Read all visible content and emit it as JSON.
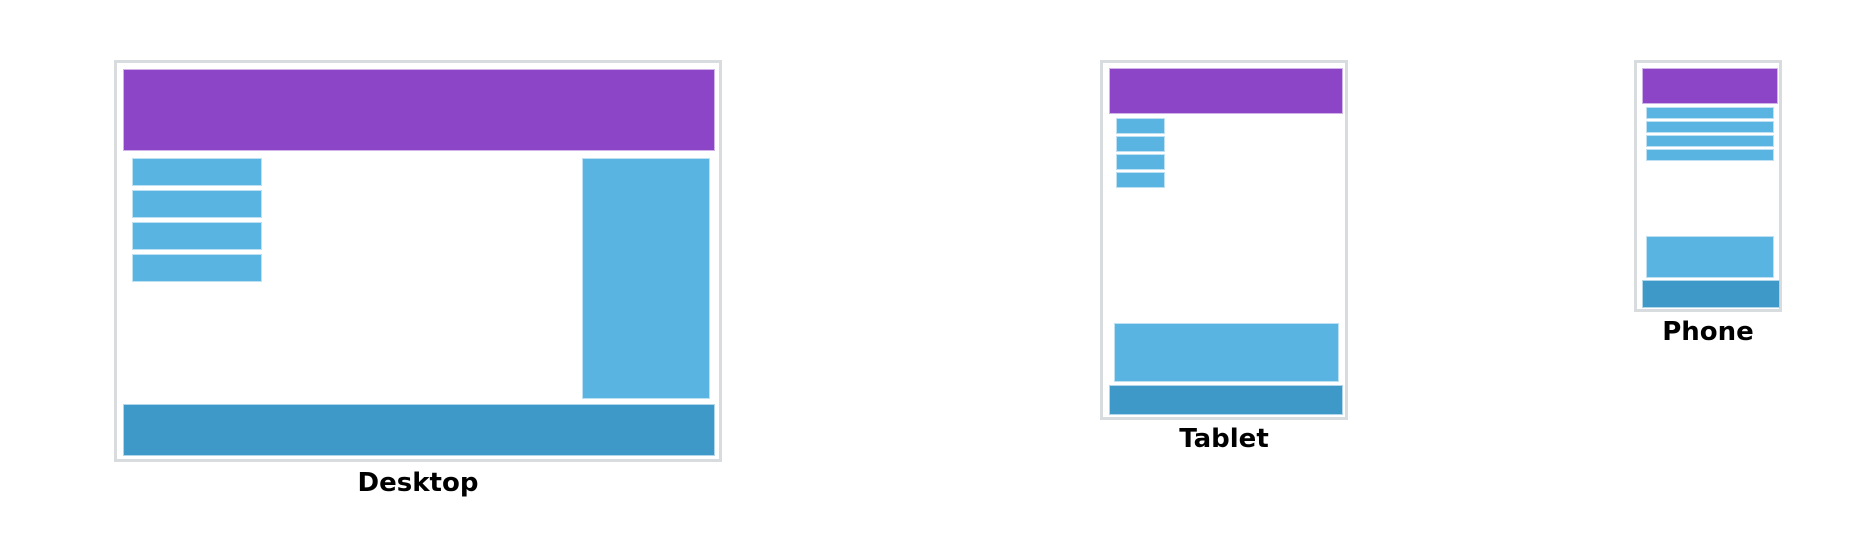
{
  "labels": {
    "desktop": "Desktop",
    "tablet": "Tablet",
    "phone": "Phone"
  },
  "colors": {
    "header": "#8b45c6",
    "block": "#5ab4e1",
    "footer": "#3e98c8",
    "frame_border": "#d9dcde"
  }
}
